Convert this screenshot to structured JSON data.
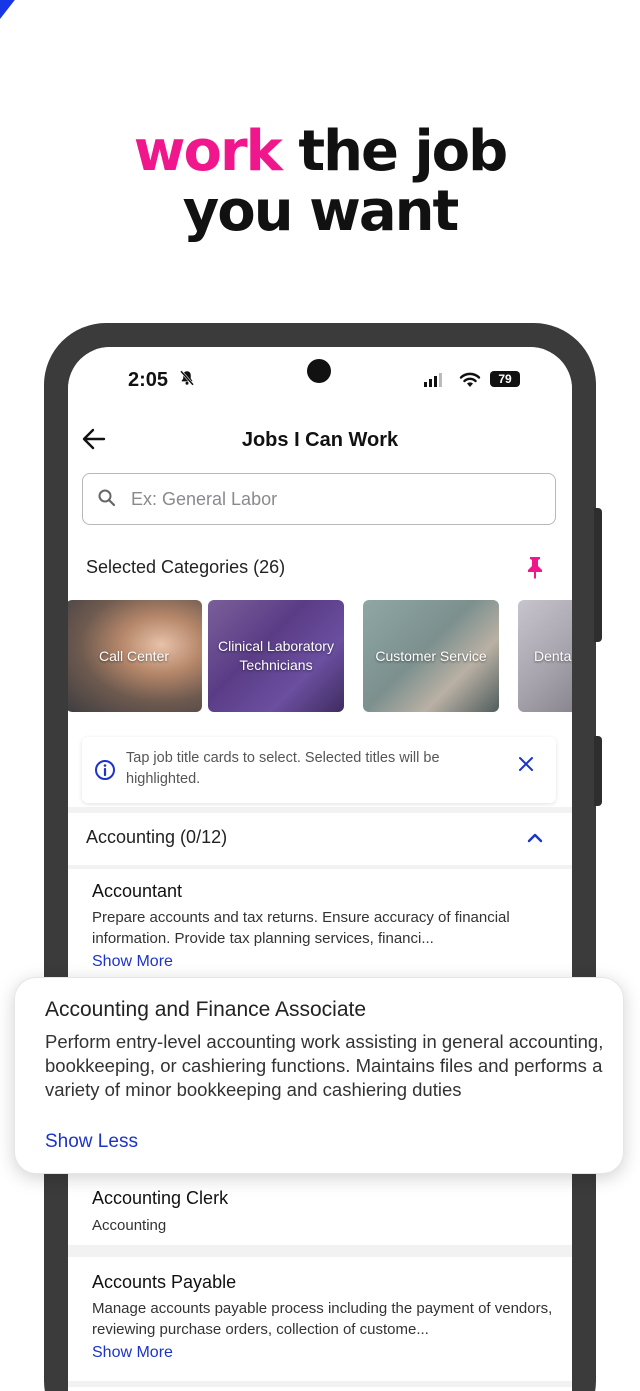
{
  "promo": {
    "headline_accent": "work",
    "headline_rest1": " the job",
    "headline_line2": "you want"
  },
  "status_bar": {
    "time": "2:05",
    "battery": "79"
  },
  "app_bar": {
    "title": "Jobs I Can Work"
  },
  "search": {
    "placeholder": "Ex: General Labor"
  },
  "categories": {
    "label": "Selected Categories (26)",
    "tiles": [
      {
        "label": "Call Center"
      },
      {
        "label": "Clinical Laboratory Technicians"
      },
      {
        "label": "Customer Service"
      },
      {
        "label": "Denta"
      }
    ]
  },
  "tip": {
    "text": "Tap job title cards to select. Selected titles will be highlighted."
  },
  "accounting": {
    "label": "Accounting (0/12)",
    "jobs": [
      {
        "title": "Accountant",
        "desc": "Prepare accounts and tax returns. Ensure accuracy of financial information. Provide tax planning services, financi...",
        "more": "Show More"
      },
      {
        "title": "Accounting Clerk",
        "desc": "Accounting"
      },
      {
        "title": "Accounts Payable",
        "desc": "Manage accounts payable process including the payment of vendors, reviewing purchase orders, collection of custome...",
        "more": "Show More"
      }
    ]
  },
  "popup": {
    "title": "Accounting and Finance Associate",
    "desc": "Perform entry-level accounting work assisting in general accounting, bookkeeping, or cashiering functions.  Maintains files and performs a variety of minor bookkeeping and cashiering duties",
    "less": "Show Less"
  },
  "colors": {
    "accent_pink": "#f0178c",
    "link_blue": "#1c34c9",
    "stripe_blue": "#1737e6"
  }
}
